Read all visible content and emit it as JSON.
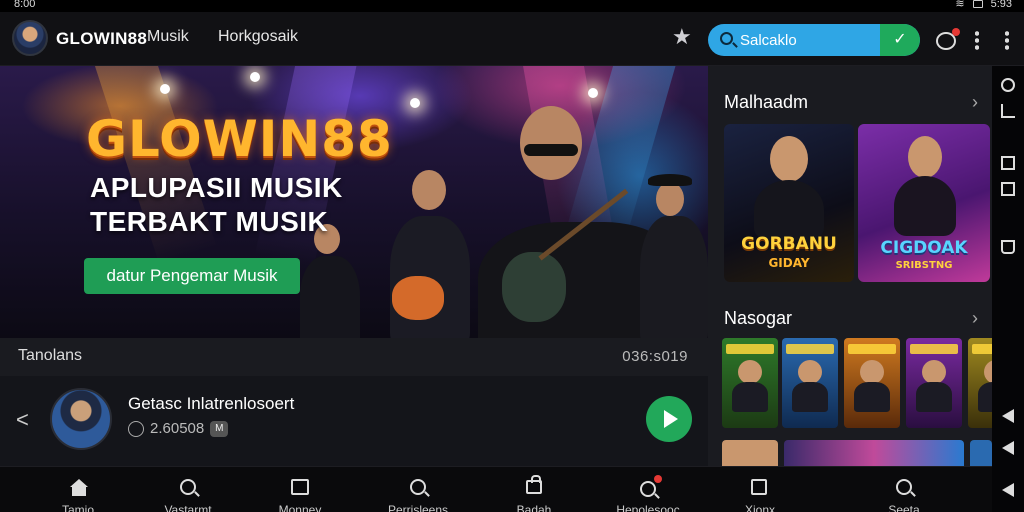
{
  "status_bar": {
    "time": "8:00",
    "battery": "5:93"
  },
  "app": {
    "brand": "GLOWIN88",
    "nav": [
      "Musik",
      "Horkgosaik"
    ],
    "search_placeholder": "Salcaklo"
  },
  "hero": {
    "title": "GLOWIN88",
    "subtitle_line1": "APLUPASII MUSIK",
    "subtitle_line2": "TERBAKT MUSIK",
    "cta": "datur Pengemar Musik",
    "strip_label": "Tanolans",
    "strip_time": "036:s019"
  },
  "now_playing": {
    "title": "Getasc Inlatrenlosoert",
    "count": "2.60508",
    "tag": "M"
  },
  "right_panel": {
    "section1_title": "Malhaadm",
    "cards": [
      {
        "caption_top": "GORBANU",
        "caption_bottom": "GIDAY"
      },
      {
        "caption_top": "CIGDOAK",
        "caption_bottom": "SRIBSTNG"
      }
    ],
    "section2_title": "Nasogar"
  },
  "bottom_nav": [
    {
      "label": "Tamio",
      "icon": "home-icon"
    },
    {
      "label": "Vastarmt",
      "icon": "search-icon"
    },
    {
      "label": "Monney",
      "icon": "library-icon"
    },
    {
      "label": "Perrisleens",
      "icon": "search-icon"
    },
    {
      "label": "Badah",
      "icon": "bag-icon"
    },
    {
      "label": "Hepolesooc",
      "icon": "notification-icon"
    },
    {
      "label": "Xionx",
      "icon": "square-icon"
    },
    {
      "label": "Seeta",
      "icon": "compass-icon"
    }
  ],
  "colors": {
    "accent_blue": "#2fa6e5",
    "accent_green": "#1f9d55",
    "title_gold": "#ffb62e",
    "background": "#0b0b0d"
  }
}
